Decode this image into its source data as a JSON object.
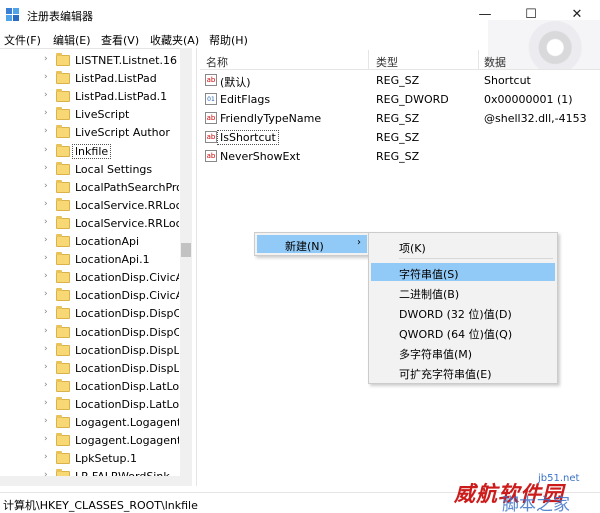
{
  "window": {
    "title": "注册表编辑器",
    "controls": {
      "minimize": "—",
      "maximize": "☐",
      "close": "✕"
    }
  },
  "menu": [
    "文件(F)",
    "编辑(E)",
    "查看(V)",
    "收藏夹(A)",
    "帮助(H)"
  ],
  "tree": {
    "items": [
      {
        "label": "LISTNET.Listnet.16",
        "expandable": true
      },
      {
        "label": "ListPad.ListPad",
        "expandable": true
      },
      {
        "label": "ListPad.ListPad.1",
        "expandable": true
      },
      {
        "label": "LiveScript",
        "expandable": true
      },
      {
        "label": "LiveScript Author",
        "expandable": true
      },
      {
        "label": "lnkfile",
        "expandable": true,
        "selected": true
      },
      {
        "label": "Local Settings",
        "expandable": true
      },
      {
        "label": "LocalPathSearchPro",
        "expandable": true
      },
      {
        "label": "LocalService.RRLoca",
        "expandable": true
      },
      {
        "label": "LocalService.RRLoca",
        "expandable": true
      },
      {
        "label": "LocationApi",
        "expandable": true
      },
      {
        "label": "LocationApi.1",
        "expandable": true
      },
      {
        "label": "LocationDisp.CivicAc",
        "expandable": true
      },
      {
        "label": "LocationDisp.CivicAc",
        "expandable": true
      },
      {
        "label": "LocationDisp.DispCi",
        "expandable": true
      },
      {
        "label": "LocationDisp.DispCi",
        "expandable": true
      },
      {
        "label": "LocationDisp.DispLa",
        "expandable": true
      },
      {
        "label": "LocationDisp.DispLa",
        "expandable": true
      },
      {
        "label": "LocationDisp.LatLor",
        "expandable": true
      },
      {
        "label": "LocationDisp.LatLor",
        "expandable": true
      },
      {
        "label": "Logagent.Logagent",
        "expandable": true
      },
      {
        "label": "Logagent.Logagent",
        "expandable": true
      },
      {
        "label": "LpkSetup.1",
        "expandable": true
      },
      {
        "label": "LR.FALRWordSink",
        "expandable": true
      }
    ]
  },
  "list": {
    "headers": {
      "name": "名称",
      "type": "类型",
      "data": "数据"
    },
    "rows": [
      {
        "icon": "ab",
        "name": "(默认)",
        "type": "REG_SZ",
        "data": "Shortcut"
      },
      {
        "icon": "bin",
        "name": "EditFlags",
        "type": "REG_DWORD",
        "data": "0x00000001 (1)"
      },
      {
        "icon": "ab",
        "name": "FriendlyTypeName",
        "type": "REG_SZ",
        "data": "@shell32.dll,-4153"
      },
      {
        "icon": "ab",
        "name": "IsShortcut",
        "type": "REG_SZ",
        "data": "",
        "editing": true
      },
      {
        "icon": "ab",
        "name": "NeverShowExt",
        "type": "REG_SZ",
        "data": ""
      }
    ]
  },
  "context_menu": {
    "new_label": "新建(N)",
    "submenu_arrow": "›",
    "submenu": [
      {
        "label": "项(K)"
      },
      {
        "label": "字符串值(S)",
        "highlighted": true
      },
      {
        "label": "二进制值(B)"
      },
      {
        "label": "DWORD (32 位)值(D)"
      },
      {
        "label": "QWORD (64 位)值(Q)"
      },
      {
        "label": "多字符串值(M)"
      },
      {
        "label": "可扩充字符串值(E)"
      }
    ]
  },
  "status": {
    "path": "计算机\\HKEY_CLASSES_ROOT\\lnkfile"
  },
  "watermark": {
    "main": "威航软件园",
    "site": "jb51.net",
    "sub": "脚本之家"
  },
  "colors": {
    "selection": "#91c9f7",
    "folder": "#f8d775",
    "watermark_red": "#cc1b1b",
    "watermark_blue": "#3b73c7"
  }
}
